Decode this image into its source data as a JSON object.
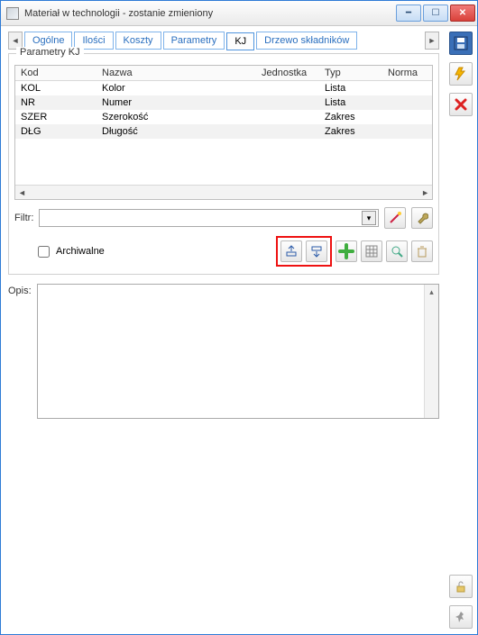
{
  "window": {
    "title": "Materiał w technologii - zostanie zmieniony"
  },
  "tabs": {
    "items": [
      "Ogólne",
      "Ilości",
      "Koszty",
      "Parametry",
      "KJ",
      "Drzewo składników"
    ],
    "active": "KJ"
  },
  "groupbox": {
    "title": "Parametry KJ"
  },
  "table": {
    "columns": [
      "Kod",
      "Nazwa",
      "Jednostka",
      "Typ",
      "Norma"
    ],
    "rows": [
      {
        "kod": "KOL",
        "nazwa": "Kolor",
        "jednostka": "",
        "typ": "Lista",
        "norma": ""
      },
      {
        "kod": "NR",
        "nazwa": "Numer",
        "jednostka": "",
        "typ": "Lista",
        "norma": ""
      },
      {
        "kod": "SZER",
        "nazwa": "Szerokość",
        "jednostka": "",
        "typ": "Zakres",
        "norma": ""
      },
      {
        "kod": "DŁG",
        "nazwa": "Długość",
        "jednostka": "",
        "typ": "Zakres",
        "norma": ""
      }
    ]
  },
  "filter": {
    "label": "Filtr:",
    "value": ""
  },
  "archive_checkbox": {
    "label": "Archiwalne",
    "checked": false
  },
  "opis": {
    "label": "Opis:",
    "value": ""
  },
  "icons": {
    "save": "save-icon",
    "flash": "flash-icon",
    "close": "close-icon",
    "lock": "lock-icon",
    "pin": "pin-icon",
    "wand": "wand-icon",
    "wrench": "wrench-icon",
    "import": "import-icon",
    "export": "export-icon",
    "add": "add-icon",
    "grid": "grid-icon",
    "zoom": "zoom-icon",
    "trash": "trash-icon"
  }
}
